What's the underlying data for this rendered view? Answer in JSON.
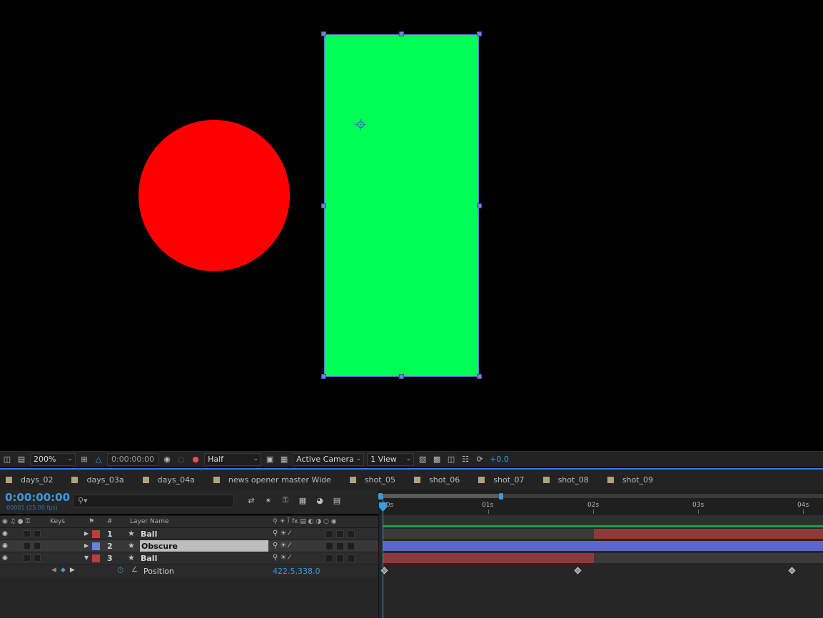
{
  "composition": {
    "objects": [
      {
        "name": "Ball",
        "shape": "circle",
        "color": "#ff0000"
      },
      {
        "name": "Obscure",
        "shape": "rectangle",
        "color": "#00ff55",
        "selected": true
      }
    ]
  },
  "viewer_toolbar": {
    "zoom": "200%",
    "timecode": "0:00:00:00",
    "resolution": "Half",
    "camera": "Active Camera",
    "views": "1 View",
    "exposure": "+0.0"
  },
  "tabs": [
    {
      "label": "days_02"
    },
    {
      "label": "days_03a"
    },
    {
      "label": "days_04a"
    },
    {
      "label": "news opener master Wide"
    },
    {
      "label": "shot_05"
    },
    {
      "label": "shot_06"
    },
    {
      "label": "shot_07"
    },
    {
      "label": "shot_08"
    },
    {
      "label": "shot_09"
    }
  ],
  "timeline": {
    "current_time": "0:00:00:00",
    "frame_info": "00001 (25.00 fps)",
    "ruler_labels": [
      "00s",
      "01s",
      "02s",
      "03s",
      "04s"
    ],
    "columns": {
      "keys": "Keys",
      "number": "#",
      "layer_name": "Layer Name"
    },
    "layers": [
      {
        "number": "1",
        "name": "Ball",
        "label_color": "#c23b3b",
        "expanded": false,
        "selected": false
      },
      {
        "number": "2",
        "name": "Obscure",
        "label_color": "#6a7fe0",
        "expanded": false,
        "selected": true
      },
      {
        "number": "3",
        "name": "Ball",
        "label_color": "#c23b3b",
        "expanded": true,
        "selected": false
      }
    ],
    "property": {
      "name": "Position",
      "value": "422.5,338.0"
    }
  },
  "colors": {
    "accent": "#3a9be0",
    "ball_bar": "#8f3a3a",
    "obscure_bar": "#5a66c8",
    "work_area": "#1aa04a"
  }
}
